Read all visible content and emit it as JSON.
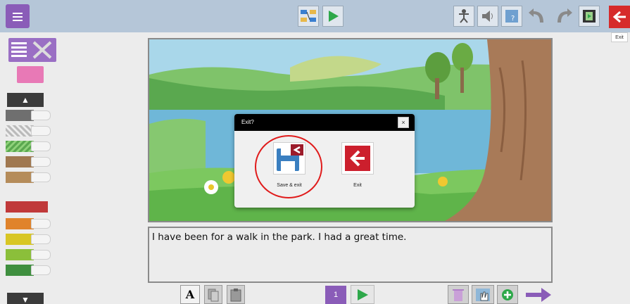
{
  "topbar": {
    "menu_icon": "hamburger-menu-icon",
    "tooltip": "Exit"
  },
  "palette": {
    "colors": [
      "#6f6f6f",
      "#c9c9c9",
      "#5aa84f",
      "#a07850",
      "#b58c5a",
      "#c0393a",
      "#e0832b",
      "#d8c624",
      "#8bbf3a",
      "#3f8f3f"
    ]
  },
  "dialog": {
    "title": "Exit?",
    "close_label": "×",
    "options": [
      {
        "label": "Save & exit",
        "icon": "save-and-exit-icon"
      },
      {
        "label": "Exit",
        "icon": "exit-arrow-icon"
      }
    ]
  },
  "story_text": "I have been for a walk in the park.  I had a great time.",
  "bottom": {
    "font_button_label": "A",
    "page_number": "1"
  },
  "colors": {
    "accent_purple": "#8a5cb8",
    "exit_red": "#d62b2b",
    "play_green": "#2ea84a"
  }
}
